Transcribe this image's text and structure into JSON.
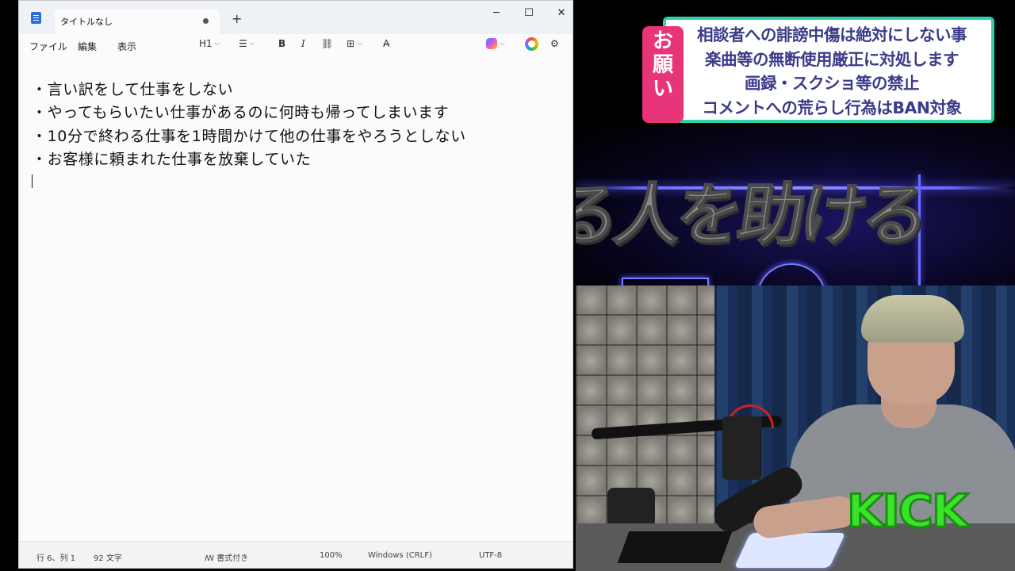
{
  "notepad": {
    "tab_title": "タイトルなし",
    "new_tab": "+",
    "window_controls": {
      "minimize": "─",
      "maximize": "☐",
      "close": "✕"
    },
    "menu": {
      "file": "ファイル",
      "edit": "編集",
      "view": "表示"
    },
    "toolbar": {
      "heading": "H1",
      "list_icon": "☰",
      "bold": "B",
      "italic": "I",
      "link_icon": "⛓",
      "table_icon": "⊞",
      "clear_format_icon": "A̶",
      "chevron": "⌵",
      "settings_icon": "⚙"
    },
    "lines": [
      "・言い訳をして仕事をしない",
      "・やってもらいたい仕事があるのに何時も帰ってしまいます",
      "・10分で終わる仕事を1時間かけて他の仕事をやろうとしない",
      "・お客様に頼まれた仕事を放棄していた"
    ],
    "status": {
      "position": "行 6、列 1",
      "char_count": "92 文字",
      "format_icon": "ꟿ",
      "format": "書式付き",
      "zoom": "100%",
      "line_ending": "Windows (CRLF)",
      "encoding": "UTF-8"
    }
  },
  "overlay": {
    "banner_tag": [
      "お",
      "願",
      "い"
    ],
    "banner_lines": [
      "相談者への誹謗中傷は絶対にしない事",
      "楽曲等の無断使用厳正に対処します",
      "画録・スクショ等の禁止",
      "コメントへの荒らし行為はBAN対象"
    ],
    "big_text": "る人を助ける",
    "kick_logo": "KICK",
    "colors": {
      "banner_border": "#2ed1a9",
      "banner_tag": "#e8357a",
      "banner_text": "#3b3b8a",
      "kick": "#39e329"
    }
  }
}
